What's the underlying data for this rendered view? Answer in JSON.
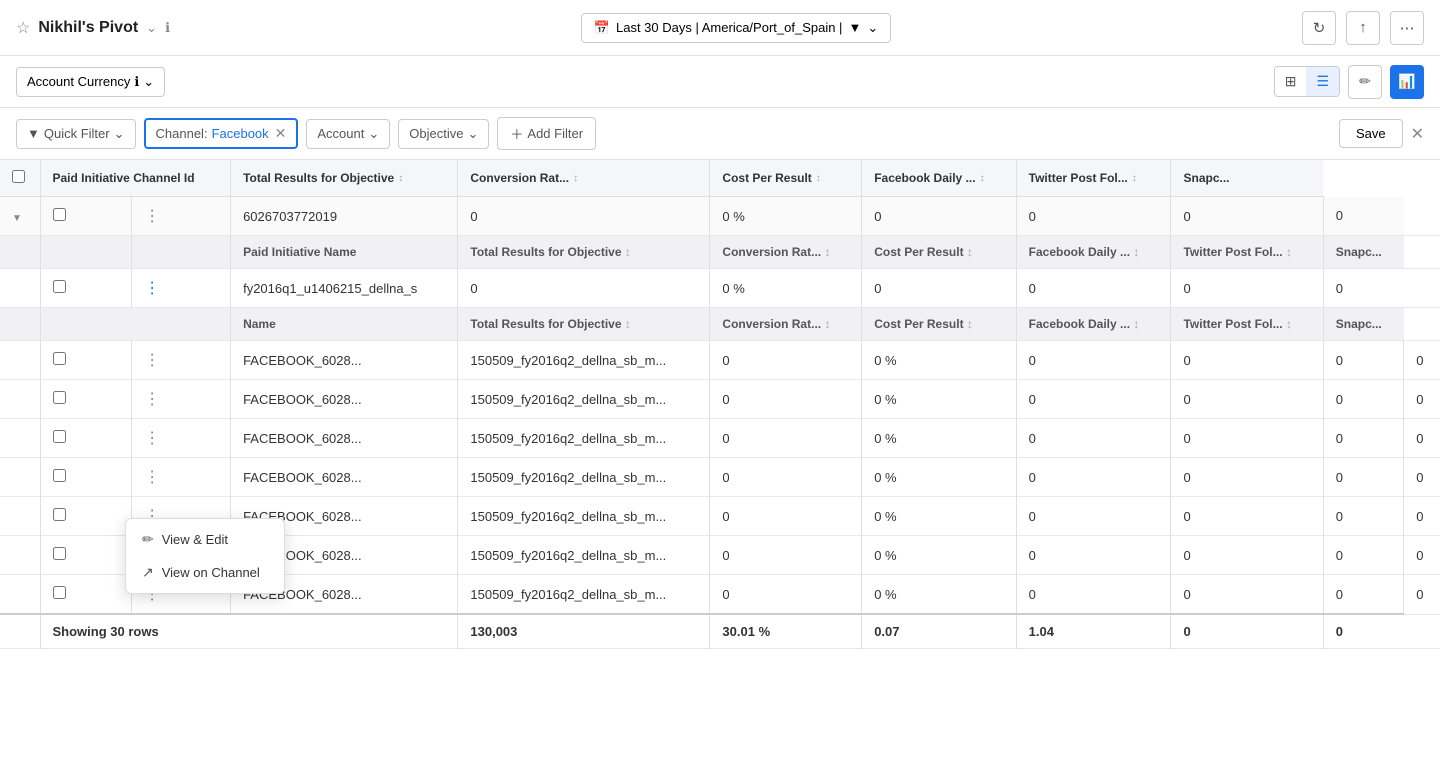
{
  "app": {
    "title": "Nikhil's Pivot",
    "info_icon": "ℹ",
    "chevron_icon": "⌄"
  },
  "date_range": {
    "label": "Last 30 Days | America/Port_of_Spain |",
    "calendar_icon": "📅"
  },
  "toolbar": {
    "refresh_label": "↻",
    "export_label": "↑",
    "more_label": "⋯"
  },
  "sub_bar": {
    "currency_label": "Account Currency",
    "info_icon": "ℹ",
    "chevron_icon": "⌄",
    "grid_icon": "⊞",
    "list_icon": "☰",
    "edit_icon": "✏",
    "chart_icon": "📊"
  },
  "filters": {
    "quick_filter_label": "Quick Filter",
    "channel_label": "Channel:",
    "channel_value": "Facebook",
    "account_label": "Account",
    "objective_label": "Objective",
    "add_filter_label": "Add Filter",
    "save_label": "Save"
  },
  "table": {
    "columns": [
      {
        "id": "channel_id",
        "label": "Paid Initiative Channel Id"
      },
      {
        "id": "results",
        "label": "Total Results for Objective"
      },
      {
        "id": "conversion_rate",
        "label": "Conversion Rat..."
      },
      {
        "id": "cost_per_result",
        "label": "Cost Per Result"
      },
      {
        "id": "facebook_daily",
        "label": "Facebook Daily ..."
      },
      {
        "id": "twitter_post",
        "label": "Twitter Post Fol..."
      },
      {
        "id": "snapchat",
        "label": "Snapc..."
      }
    ],
    "group_rows": [
      {
        "id": "6026703772019",
        "results": "0",
        "conversion_rate": "0 %",
        "cost_per_result": "0",
        "facebook_daily": "0",
        "twitter_post": "0",
        "snapchat": "0",
        "sub_header": "Paid Initiative Name",
        "children": [
          {
            "channel_id": "fy2016q1_u1406215_dellna_s",
            "name": "",
            "results": "0",
            "conversion_rate": "0 %",
            "cost_per_result": "0",
            "facebook_daily": "0",
            "twitter_post": "0",
            "snapchat": "0",
            "show_context": true
          }
        ]
      }
    ],
    "data_rows": [
      {
        "channel_id": "FACEBOOK_6028...",
        "name": "150509_fy2016q2_dellna_sb_m...",
        "results": "0",
        "conversion_rate": "0 %",
        "cost_per_result": "0",
        "facebook_daily": "0",
        "twitter_post": "0",
        "snapchat": "0"
      },
      {
        "channel_id": "FACEBOOK_6028...",
        "name": "150509_fy2016q2_dellna_sb_m...",
        "results": "0",
        "conversion_rate": "0 %",
        "cost_per_result": "0",
        "facebook_daily": "0",
        "twitter_post": "0",
        "snapchat": "0"
      },
      {
        "channel_id": "FACEBOOK_6028...",
        "name": "150509_fy2016q2_dellna_sb_m...",
        "results": "0",
        "conversion_rate": "0 %",
        "cost_per_result": "0",
        "facebook_daily": "0",
        "twitter_post": "0",
        "snapchat": "0"
      },
      {
        "channel_id": "FACEBOOK_6028...",
        "name": "150509_fy2016q2_dellna_sb_m...",
        "results": "0",
        "conversion_rate": "0 %",
        "cost_per_result": "0",
        "facebook_daily": "0",
        "twitter_post": "0",
        "snapchat": "0"
      },
      {
        "channel_id": "FACEBOOK_6028...",
        "name": "150509_fy2016q2_dellna_sb_m...",
        "results": "0",
        "conversion_rate": "0 %",
        "cost_per_result": "0",
        "facebook_daily": "0",
        "twitter_post": "0",
        "snapchat": "0"
      },
      {
        "channel_id": "FACEBOOK_6028...",
        "name": "150509_fy2016q2_dellna_sb_m...",
        "results": "0",
        "conversion_rate": "0 %",
        "cost_per_result": "0",
        "facebook_daily": "0",
        "twitter_post": "0",
        "snapchat": "0"
      },
      {
        "channel_id": "FACEBOOK_6028...",
        "name": "150509_fy2016q2_dellna_sb_m...",
        "results": "0",
        "conversion_rate": "0 %",
        "cost_per_result": "0",
        "facebook_daily": "0",
        "twitter_post": "0",
        "snapchat": "0"
      }
    ],
    "footer": {
      "showing_label": "Showing 30 rows",
      "results_total": "130,003",
      "conversion_total": "30.01 %",
      "cost_total": "0.07",
      "facebook_total": "1.04",
      "twitter_total": "0",
      "snapchat_total": "0"
    },
    "sub_header_rows": {
      "label": "Total Results for Objective",
      "second_sub_label": "Total Results for Objective",
      "third_sub_label": "Total Results for Objective"
    }
  },
  "context_menu": {
    "view_edit_label": "View & Edit",
    "view_channel_label": "View on Channel",
    "edit_icon": "✏",
    "external_icon": "↗"
  }
}
